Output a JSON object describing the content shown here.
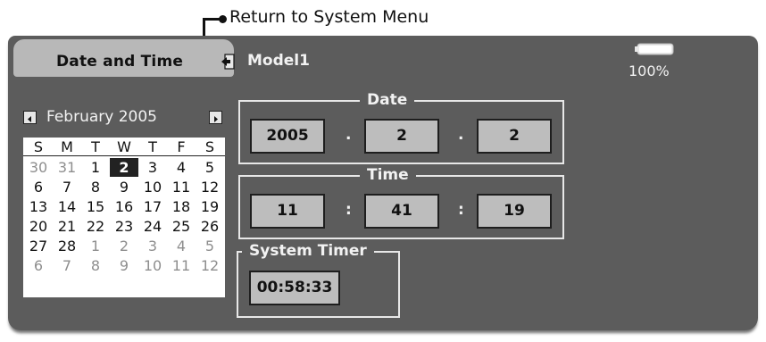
{
  "annotation": {
    "label": "●Return to System Menu",
    "text": "Return to System Menu"
  },
  "header": {
    "title": "Date and Time",
    "model": "Model1",
    "battery_percent": "100%"
  },
  "calendar": {
    "month_label": "February 2005",
    "weekdays": [
      "S",
      "M",
      "T",
      "W",
      "T",
      "F",
      "S"
    ],
    "weeks": [
      [
        "30",
        "31",
        "1",
        "2",
        "3",
        "4",
        "5"
      ],
      [
        "6",
        "7",
        "8",
        "9",
        "10",
        "11",
        "12"
      ],
      [
        "13",
        "14",
        "15",
        "16",
        "17",
        "18",
        "19"
      ],
      [
        "20",
        "21",
        "22",
        "23",
        "24",
        "25",
        "26"
      ],
      [
        "27",
        "28",
        "1",
        "2",
        "3",
        "4",
        "5"
      ],
      [
        "6",
        "7",
        "8",
        "9",
        "10",
        "11",
        "12"
      ]
    ],
    "selected_day": "2"
  },
  "date": {
    "label": "Date",
    "year": "2005",
    "month": "2",
    "day": "2",
    "separator": "."
  },
  "time": {
    "label": "Time",
    "hour": "11",
    "minute": "41",
    "second": "19",
    "separator": ":"
  },
  "system_timer": {
    "label": "System Timer",
    "value": "00:58:33"
  },
  "colors": {
    "screen_bg": "#5c5c5c",
    "field_bg": "#bdbdbd",
    "tab_bg": "#b8b8b8"
  }
}
